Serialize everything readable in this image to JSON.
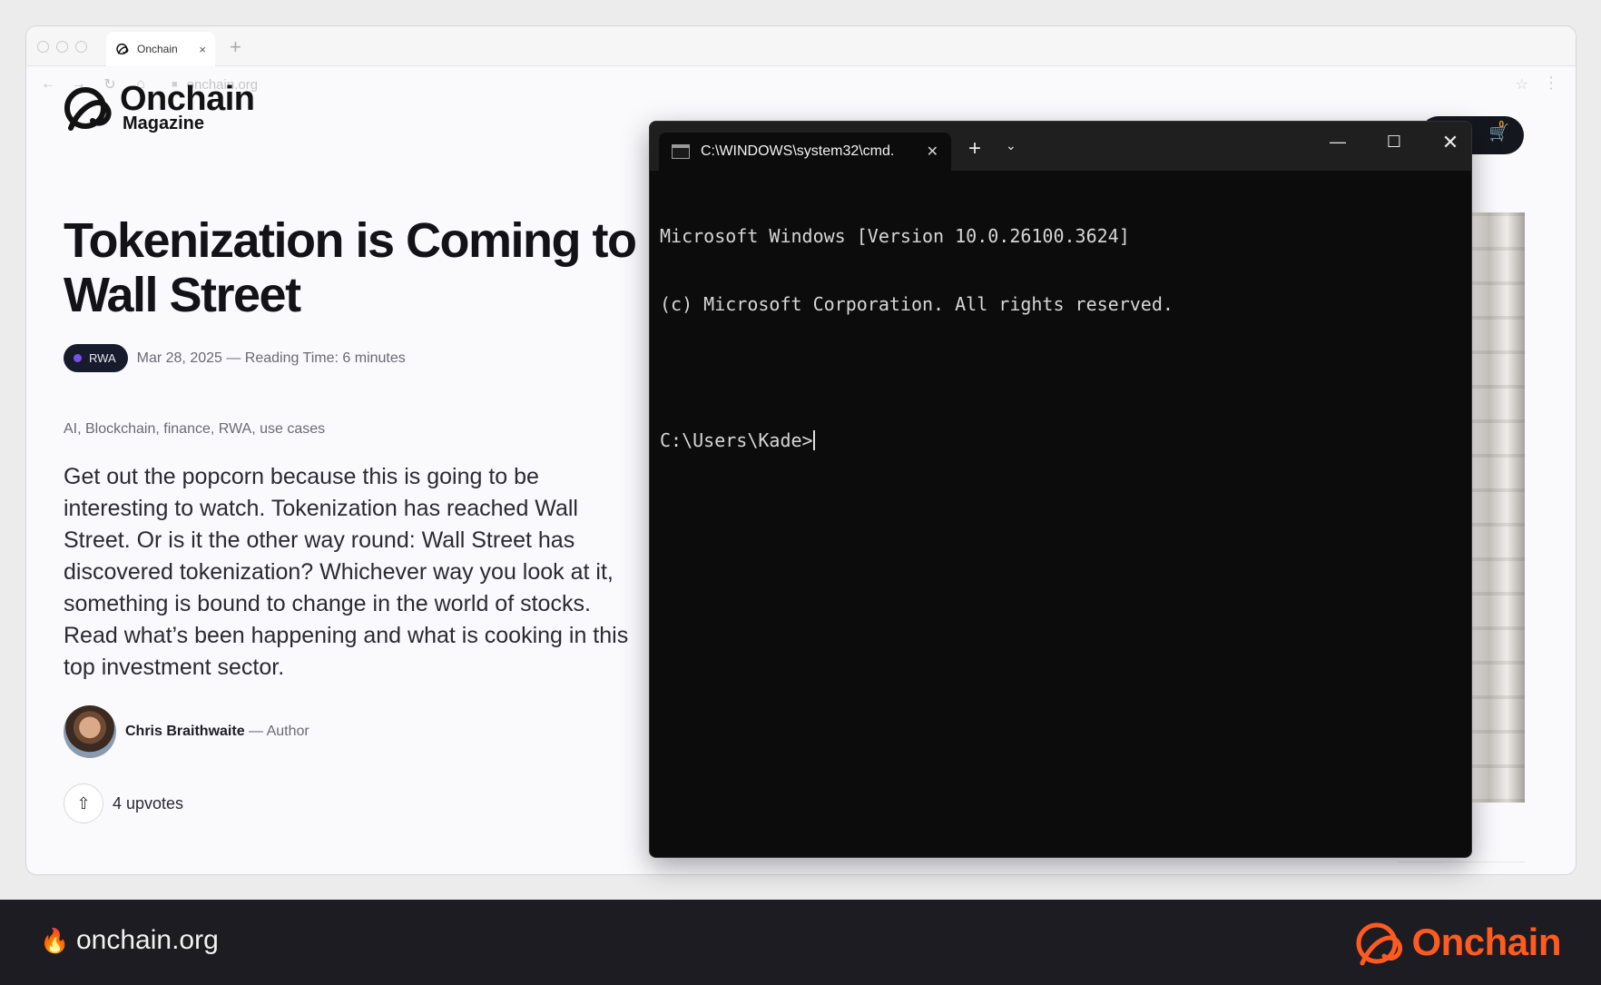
{
  "browser": {
    "tab_title": "Onchain",
    "tab_close": "×",
    "new_tab": "+",
    "url": "onchain.org"
  },
  "site": {
    "logo_name": "Onchain",
    "logo_sub": "Magazine",
    "cart_count": "0"
  },
  "article": {
    "title": "Tokenization is Coming to Wall Street",
    "badge": "RWA",
    "meta": "Mar 28, 2025 — Reading Time: 6 minutes",
    "tags": "AI, Blockchain, finance, RWA, use cases",
    "intro": "Get out the popcorn because this is going to be interesting to watch. Tokenization has reached Wall Street. Or is it the other way round: Wall Street has discovered tokenization? Whichever way you look at it, something is bound to change in the world of stocks. Read what’s been happening and what is cooking in this top investment sector.",
    "author_name": "Chris Braithwaite",
    "author_role": "— Author",
    "upvotes": "4 upvotes"
  },
  "cmd": {
    "tab_title": "C:\\WINDOWS\\system32\\cmd.",
    "lines": [
      "Microsoft Windows [Version 10.0.26100.3624]",
      "(c) Microsoft Corporation. All rights reserved."
    ],
    "prompt": "C:\\Users\\Kade>"
  },
  "footer": {
    "url": "onchain.org",
    "logo_text": "Onchain"
  },
  "colors": {
    "brand_orange": "#ff5a1f",
    "badge_bg": "#171b2c",
    "badge_dot": "#7a4ff0",
    "terminal_bg": "#0c0c0c"
  }
}
